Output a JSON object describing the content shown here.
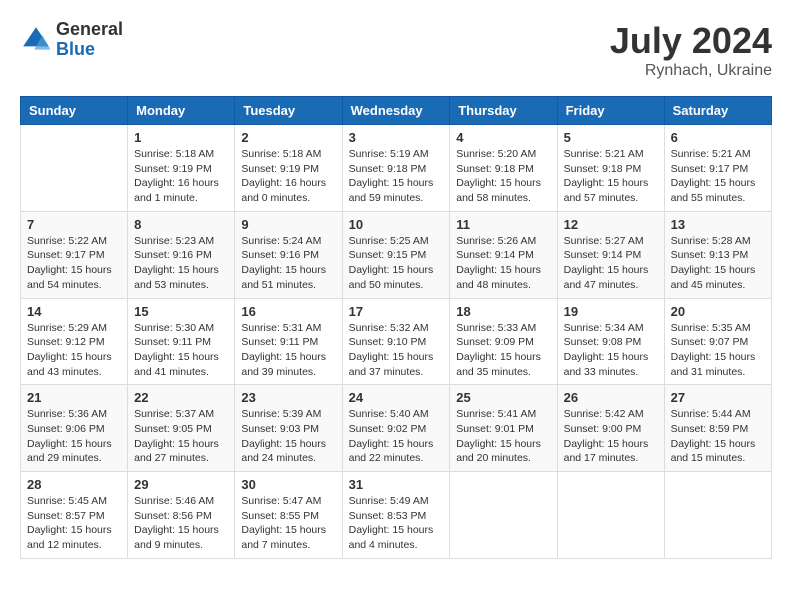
{
  "header": {
    "logo_general": "General",
    "logo_blue": "Blue",
    "month_title": "July 2024",
    "location": "Rynhach, Ukraine"
  },
  "days_of_week": [
    "Sunday",
    "Monday",
    "Tuesday",
    "Wednesday",
    "Thursday",
    "Friday",
    "Saturday"
  ],
  "weeks": [
    [
      {
        "day": "",
        "info": ""
      },
      {
        "day": "1",
        "info": "Sunrise: 5:18 AM\nSunset: 9:19 PM\nDaylight: 16 hours\nand 1 minute."
      },
      {
        "day": "2",
        "info": "Sunrise: 5:18 AM\nSunset: 9:19 PM\nDaylight: 16 hours\nand 0 minutes."
      },
      {
        "day": "3",
        "info": "Sunrise: 5:19 AM\nSunset: 9:18 PM\nDaylight: 15 hours\nand 59 minutes."
      },
      {
        "day": "4",
        "info": "Sunrise: 5:20 AM\nSunset: 9:18 PM\nDaylight: 15 hours\nand 58 minutes."
      },
      {
        "day": "5",
        "info": "Sunrise: 5:21 AM\nSunset: 9:18 PM\nDaylight: 15 hours\nand 57 minutes."
      },
      {
        "day": "6",
        "info": "Sunrise: 5:21 AM\nSunset: 9:17 PM\nDaylight: 15 hours\nand 55 minutes."
      }
    ],
    [
      {
        "day": "7",
        "info": "Sunrise: 5:22 AM\nSunset: 9:17 PM\nDaylight: 15 hours\nand 54 minutes."
      },
      {
        "day": "8",
        "info": "Sunrise: 5:23 AM\nSunset: 9:16 PM\nDaylight: 15 hours\nand 53 minutes."
      },
      {
        "day": "9",
        "info": "Sunrise: 5:24 AM\nSunset: 9:16 PM\nDaylight: 15 hours\nand 51 minutes."
      },
      {
        "day": "10",
        "info": "Sunrise: 5:25 AM\nSunset: 9:15 PM\nDaylight: 15 hours\nand 50 minutes."
      },
      {
        "day": "11",
        "info": "Sunrise: 5:26 AM\nSunset: 9:14 PM\nDaylight: 15 hours\nand 48 minutes."
      },
      {
        "day": "12",
        "info": "Sunrise: 5:27 AM\nSunset: 9:14 PM\nDaylight: 15 hours\nand 47 minutes."
      },
      {
        "day": "13",
        "info": "Sunrise: 5:28 AM\nSunset: 9:13 PM\nDaylight: 15 hours\nand 45 minutes."
      }
    ],
    [
      {
        "day": "14",
        "info": "Sunrise: 5:29 AM\nSunset: 9:12 PM\nDaylight: 15 hours\nand 43 minutes."
      },
      {
        "day": "15",
        "info": "Sunrise: 5:30 AM\nSunset: 9:11 PM\nDaylight: 15 hours\nand 41 minutes."
      },
      {
        "day": "16",
        "info": "Sunrise: 5:31 AM\nSunset: 9:11 PM\nDaylight: 15 hours\nand 39 minutes."
      },
      {
        "day": "17",
        "info": "Sunrise: 5:32 AM\nSunset: 9:10 PM\nDaylight: 15 hours\nand 37 minutes."
      },
      {
        "day": "18",
        "info": "Sunrise: 5:33 AM\nSunset: 9:09 PM\nDaylight: 15 hours\nand 35 minutes."
      },
      {
        "day": "19",
        "info": "Sunrise: 5:34 AM\nSunset: 9:08 PM\nDaylight: 15 hours\nand 33 minutes."
      },
      {
        "day": "20",
        "info": "Sunrise: 5:35 AM\nSunset: 9:07 PM\nDaylight: 15 hours\nand 31 minutes."
      }
    ],
    [
      {
        "day": "21",
        "info": "Sunrise: 5:36 AM\nSunset: 9:06 PM\nDaylight: 15 hours\nand 29 minutes."
      },
      {
        "day": "22",
        "info": "Sunrise: 5:37 AM\nSunset: 9:05 PM\nDaylight: 15 hours\nand 27 minutes."
      },
      {
        "day": "23",
        "info": "Sunrise: 5:39 AM\nSunset: 9:03 PM\nDaylight: 15 hours\nand 24 minutes."
      },
      {
        "day": "24",
        "info": "Sunrise: 5:40 AM\nSunset: 9:02 PM\nDaylight: 15 hours\nand 22 minutes."
      },
      {
        "day": "25",
        "info": "Sunrise: 5:41 AM\nSunset: 9:01 PM\nDaylight: 15 hours\nand 20 minutes."
      },
      {
        "day": "26",
        "info": "Sunrise: 5:42 AM\nSunset: 9:00 PM\nDaylight: 15 hours\nand 17 minutes."
      },
      {
        "day": "27",
        "info": "Sunrise: 5:44 AM\nSunset: 8:59 PM\nDaylight: 15 hours\nand 15 minutes."
      }
    ],
    [
      {
        "day": "28",
        "info": "Sunrise: 5:45 AM\nSunset: 8:57 PM\nDaylight: 15 hours\nand 12 minutes."
      },
      {
        "day": "29",
        "info": "Sunrise: 5:46 AM\nSunset: 8:56 PM\nDaylight: 15 hours\nand 9 minutes."
      },
      {
        "day": "30",
        "info": "Sunrise: 5:47 AM\nSunset: 8:55 PM\nDaylight: 15 hours\nand 7 minutes."
      },
      {
        "day": "31",
        "info": "Sunrise: 5:49 AM\nSunset: 8:53 PM\nDaylight: 15 hours\nand 4 minutes."
      },
      {
        "day": "",
        "info": ""
      },
      {
        "day": "",
        "info": ""
      },
      {
        "day": "",
        "info": ""
      }
    ]
  ]
}
